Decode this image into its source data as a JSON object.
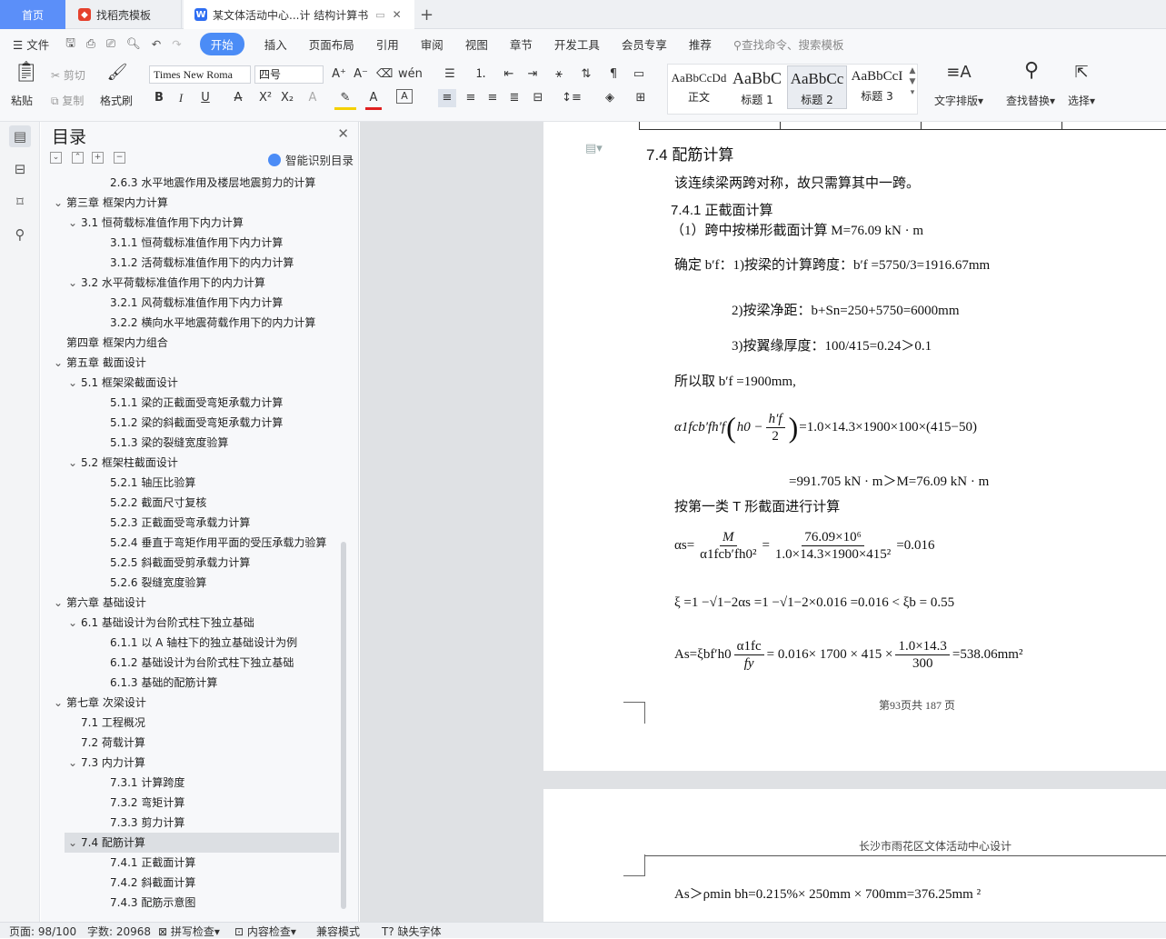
{
  "tabs": {
    "home": "首页",
    "template": "找稻壳模板",
    "document": "某文体活动中心...计 结构计算书",
    "add": "+"
  },
  "menu": {
    "file": "文件",
    "items": [
      "开始",
      "插入",
      "页面布局",
      "引用",
      "审阅",
      "视图",
      "章节",
      "开发工具",
      "会员专享",
      "推荐"
    ],
    "search_placeholder": "查找命令、搜索模板"
  },
  "ribbon": {
    "paste": "粘贴",
    "cut": "剪切",
    "copy": "复制",
    "format_painter": "格式刷",
    "font_name": "Times New Roma",
    "font_size": "四号",
    "styles": [
      {
        "preview": "AaBbCcDd",
        "label": "正文"
      },
      {
        "preview": "AaBbC",
        "label": "标题 1"
      },
      {
        "preview": "AaBbCc",
        "label": "标题 2"
      },
      {
        "preview": "AaBbCcI",
        "label": "标题 3"
      }
    ],
    "text_layout": "文字排版",
    "find_replace": "查找替换",
    "select": "选择"
  },
  "toc": {
    "title": "目录",
    "smart": "智能识别目录",
    "items": [
      {
        "text": "2.6.3 水平地震作用及楼层地震剪力的计算",
        "level": 2,
        "chev": ""
      },
      {
        "text": "第三章  框架内力计算",
        "level": 0,
        "chev": "v"
      },
      {
        "text": "3.1  恒荷载标准值作用下内力计算",
        "level": 1,
        "chev": "v"
      },
      {
        "text": "3.1.1  恒荷载标准值作用下内力计算",
        "level": 2,
        "chev": ""
      },
      {
        "text": "3.1.2  活荷载标准值作用下的内力计算",
        "level": 2,
        "chev": ""
      },
      {
        "text": "3.2  水平荷载标准值作用下的内力计算",
        "level": 1,
        "chev": "v"
      },
      {
        "text": "3.2.1  风荷载标准值作用下内力计算",
        "level": 2,
        "chev": ""
      },
      {
        "text": "3.2.2  横向水平地震荷载作用下的内力计算",
        "level": 2,
        "chev": ""
      },
      {
        "text": "第四章  框架内力组合",
        "level": 0,
        "chev": ""
      },
      {
        "text": "第五章  截面设计",
        "level": 0,
        "chev": "v"
      },
      {
        "text": "5.1  框架梁截面设计",
        "level": 1,
        "chev": "v"
      },
      {
        "text": "5.1.1  梁的正截面受弯矩承载力计算",
        "level": 2,
        "chev": ""
      },
      {
        "text": "5.1.2  梁的斜截面受弯矩承载力计算",
        "level": 2,
        "chev": ""
      },
      {
        "text": "5.1.3  梁的裂缝宽度验算",
        "level": 2,
        "chev": ""
      },
      {
        "text": "5.2  框架柱截面设计",
        "level": 1,
        "chev": "v"
      },
      {
        "text": "5.2.1  轴压比验算",
        "level": 2,
        "chev": ""
      },
      {
        "text": "5.2.2  截面尺寸复核",
        "level": 2,
        "chev": ""
      },
      {
        "text": "5.2.3  正截面受弯承载力计算",
        "level": 2,
        "chev": ""
      },
      {
        "text": "5.2.4  垂直于弯矩作用平面的受压承载力验算",
        "level": 2,
        "chev": ""
      },
      {
        "text": "5.2.5  斜截面受剪承载力计算",
        "level": 2,
        "chev": ""
      },
      {
        "text": "5.2.6  裂缝宽度验算",
        "level": 2,
        "chev": ""
      },
      {
        "text": "第六章  基础设计",
        "level": 0,
        "chev": "v"
      },
      {
        "text": "6.1 基础设计为台阶式柱下独立基础",
        "level": 1,
        "chev": "v"
      },
      {
        "text": "6.1.1 以 A 轴柱下的独立基础设计为例",
        "level": 2,
        "chev": ""
      },
      {
        "text": "6.1.2 基础设计为台阶式柱下独立基础",
        "level": 2,
        "chev": ""
      },
      {
        "text": "6.1.3 基础的配筋计算",
        "level": 2,
        "chev": ""
      },
      {
        "text": "第七章  次梁设计",
        "level": 0,
        "chev": "v"
      },
      {
        "text": "7.1  工程概况",
        "level": 1,
        "chev": ""
      },
      {
        "text": "7.2  荷载计算",
        "level": 1,
        "chev": ""
      },
      {
        "text": "7.3  内力计算",
        "level": 1,
        "chev": "v"
      },
      {
        "text": "7.3.1 计算跨度",
        "level": 2,
        "chev": ""
      },
      {
        "text": "7.3.2 弯矩计算",
        "level": 2,
        "chev": ""
      },
      {
        "text": "7.3.3 剪力计算",
        "level": 2,
        "chev": ""
      },
      {
        "text": "7.4  配筋计算",
        "level": 1,
        "chev": "v",
        "active": true
      },
      {
        "text": "7.4.1 正截面计算",
        "level": 2,
        "chev": ""
      },
      {
        "text": "7.4.2 斜截面计算",
        "level": 2,
        "chev": ""
      },
      {
        "text": "7.4.3 配筋示意图",
        "level": 2,
        "chev": ""
      }
    ]
  },
  "document": {
    "heading": "7.4  配筋计算",
    "intro": "该连续梁两跨对称，故只需算其中一跨。",
    "sub_heading": "7.4.1 正截面计算",
    "item1": "（1）跨中按梯形截面计算 M=76.09 kN · m",
    "bf_line": "确定 b′f：1)按梁的计算跨度：b′f =5750/3=1916.67mm",
    "clear_span": "2)按梁净距：b+Sn=250+5750=6000mm",
    "flange": "3)按翼缘厚度：100/415=0.24＞0.1",
    "take_bf": "所以取 b′f =1900mm,",
    "moment_rhs": "=1.0×14.3×1900×100×(415−50)",
    "moment_result": "=991.705 kN · m＞M=76.09 kN · m",
    "type1": "按第一类 T 形截面进行计算",
    "alpha_rhs": "=0.016",
    "xi_line": "ξ =1 −√1−2αs =1 −√1−2×0.016 =0.016 < ξb = 0.55",
    "as_mid": "= 0.016× 1700 × 415 ×",
    "as_rhs": "=538.06mm²",
    "page_no": "第93页共 187 页",
    "header2": "长沙市雨花区文体活动中心设计",
    "as_min": "As＞ρmin bh=0.215%× 250mm × 700mm=376.25mm ²",
    "frac_alpha_num": "M",
    "frac_alpha_den": "α1fcb′fh0²",
    "frac_alpha_num2": "76.09×10⁶",
    "frac_alpha_den2": "1.0×14.3×1900×415²",
    "frac_as_num": "α1fc",
    "frac_as_den": "fy",
    "frac_as_num2": "1.0×14.3",
    "frac_as_den2": "300",
    "moment_lhs": "α1fcb′fh′f",
    "h_expr": "h0 −",
    "h_num": "h′f",
    "h_den": "2",
    "alpha_lhs": "αs=",
    "as_lhs": "As=ξbf′h0"
  },
  "status": {
    "page": "页面: 98/100",
    "words": "字数: 20968",
    "spell": "拼写检查",
    "content_check": "内容检查",
    "compat": "兼容模式",
    "missing_font": "缺失字体"
  }
}
